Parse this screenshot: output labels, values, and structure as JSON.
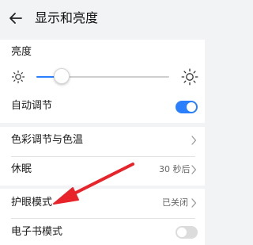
{
  "header": {
    "title": "显示和亮度"
  },
  "brightness": {
    "label": "亮度",
    "level_percent": 19
  },
  "auto_adjust": {
    "label": "自动调节",
    "enabled": true
  },
  "color": {
    "label": "色彩调节与色温"
  },
  "sleep": {
    "label": "休眠",
    "value": "30 秒后"
  },
  "eye_care": {
    "label": "护眼模式",
    "value": "已关闭"
  },
  "ebook": {
    "label": "电子书模式",
    "enabled": false
  },
  "colors": {
    "accent": "#2a7fff",
    "annotation_arrow": "#e8232a"
  },
  "icons": {
    "back": "back-arrow-icon",
    "sun_small": "sun-small-icon",
    "sun_large": "sun-large-icon",
    "chevron": "chevron-right-icon"
  }
}
